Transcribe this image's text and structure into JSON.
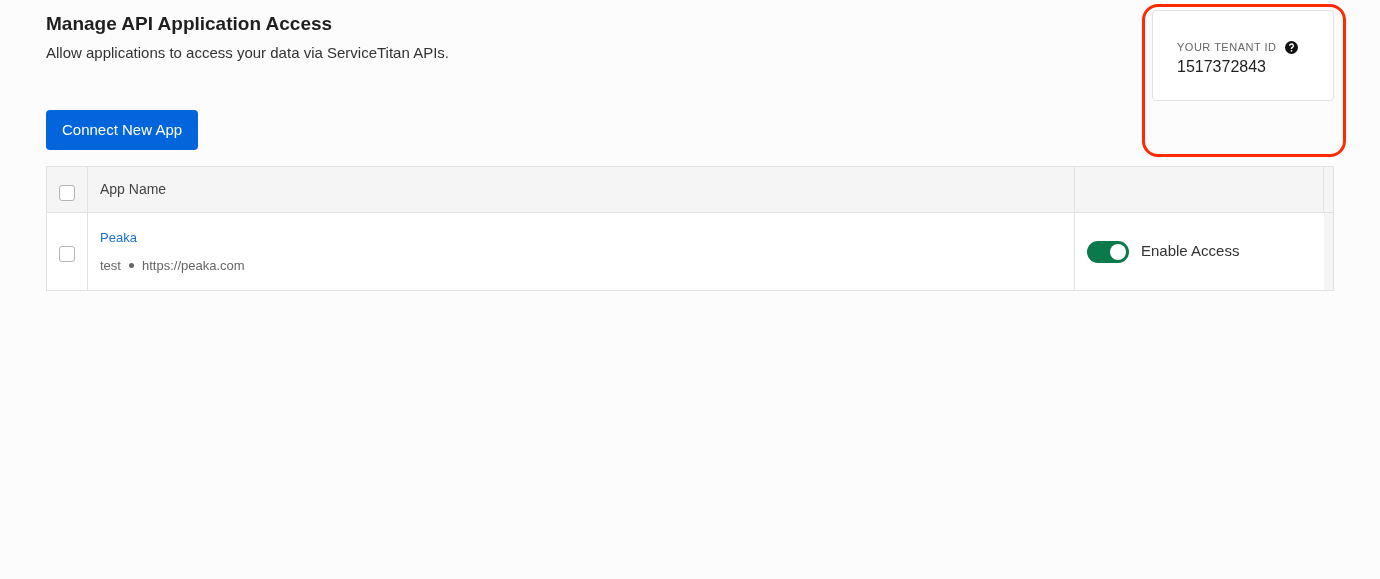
{
  "header": {
    "title": "Manage API Application Access",
    "subtitle": "Allow applications to access your data via ServiceTitan APIs."
  },
  "connect_button": {
    "label": "Connect New App"
  },
  "tenant": {
    "label": "YOUR TENANT ID",
    "value": "1517372843",
    "highlighted": true
  },
  "table": {
    "select_all": {
      "checked": false
    },
    "columns": [
      {
        "label": "App Name"
      }
    ],
    "rows": [
      {
        "checked": false,
        "name": "Peaka",
        "description": "test",
        "url": "https://peaka.com",
        "access": {
          "on": true,
          "label": "Enable Access"
        }
      }
    ]
  }
}
